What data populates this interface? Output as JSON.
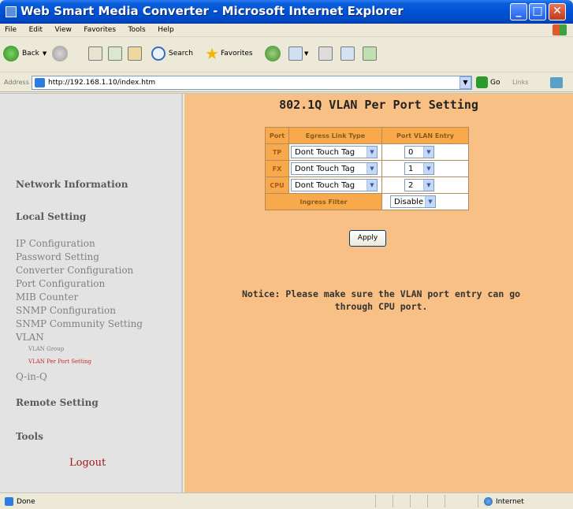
{
  "window": {
    "title": "Web Smart Media Converter - Microsoft Internet Explorer",
    "buttons": {
      "minimize": "_",
      "maximize": "□",
      "close": "✕"
    }
  },
  "menu": [
    "File",
    "Edit",
    "View",
    "Favorites",
    "Tools",
    "Help"
  ],
  "toolbar": {
    "back": "Back",
    "search": "Search",
    "favorites": "Favorites"
  },
  "address": {
    "label": "Address",
    "url": "http://192.168.1.10/index.htm",
    "go": "Go",
    "links": "Links"
  },
  "sidebar": {
    "network_information": "Network Information",
    "local_setting": "Local Setting",
    "items": [
      "IP Configuration",
      "Password Setting",
      "Converter Configuration",
      "Port Configuration",
      "MIB Counter",
      "SNMP Configuration",
      "SNMP Community Setting",
      "VLAN"
    ],
    "vlan_sub": [
      "VLAN Group",
      "VLAN Per Port Setting"
    ],
    "qinq": "Q-in-Q",
    "remote_setting": "Remote Setting",
    "tools": "Tools",
    "logout": "Logout"
  },
  "main": {
    "title": "802.1Q VLAN Per Port Setting",
    "table": {
      "headers": [
        "Port",
        "Egress Link Type",
        "Port VLAN Entry"
      ],
      "rows": [
        {
          "port": "TP",
          "egress": "Dont Touch Tag",
          "pvid": "0"
        },
        {
          "port": "FX",
          "egress": "Dont Touch Tag",
          "pvid": "1"
        },
        {
          "port": "CPU",
          "egress": "Dont Touch Tag",
          "pvid": "2"
        }
      ],
      "ingress_label": "Ingress Filter",
      "ingress_value": "Disable"
    },
    "apply": "Apply",
    "notice_line1": "Notice: Please make sure the VLAN port entry can go",
    "notice_line2": "through CPU port."
  },
  "status": {
    "left": "Done",
    "zone": "Internet"
  }
}
